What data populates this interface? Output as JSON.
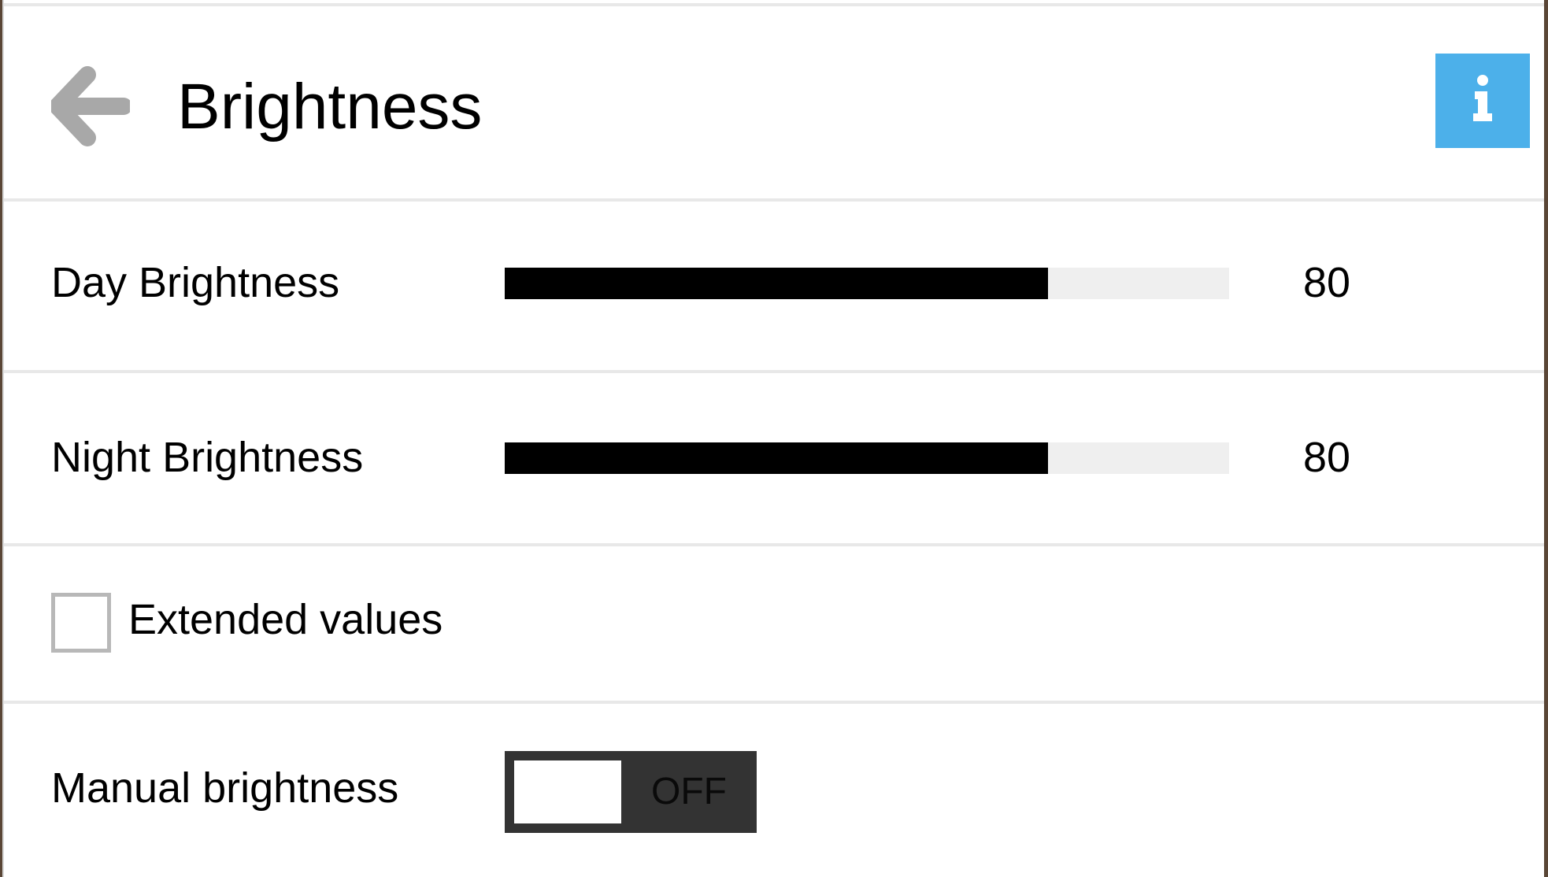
{
  "header": {
    "title": "Brightness",
    "back_icon": "back-arrow-icon",
    "info_icon": "info-icon",
    "info_color": "#4cb0ea"
  },
  "settings": {
    "day": {
      "label": "Day Brightness",
      "value": "80",
      "level_fraction": 0.75
    },
    "night": {
      "label": "Night Brightness",
      "value": "80",
      "level_fraction": 0.75
    },
    "extended": {
      "label": "Extended values",
      "checked": false
    },
    "manual": {
      "label": "Manual brightness",
      "state": "OFF"
    }
  }
}
